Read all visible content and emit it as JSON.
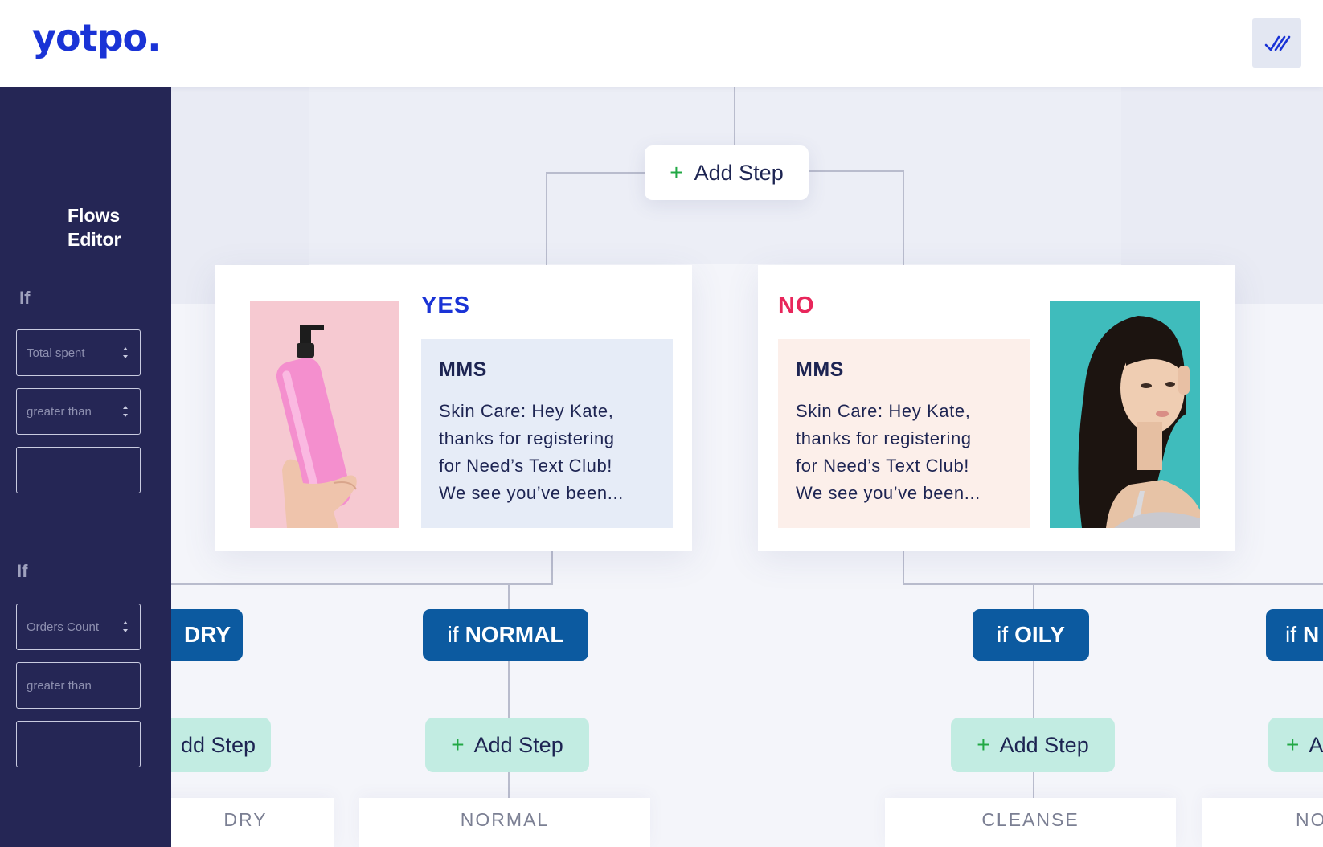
{
  "header": {
    "logo": "yotpo.",
    "check_icon": "double-check-icon"
  },
  "sidebar": {
    "title_line1": "Flows",
    "title_line2": "Editor",
    "groups": [
      {
        "if_label": "If",
        "field1": "Total spent",
        "field2": "greater than",
        "field3": ""
      },
      {
        "if_label": "If",
        "field1": "Orders Count",
        "field2": "greater than",
        "field3": ""
      }
    ]
  },
  "flow": {
    "top_add_step": "Add Step",
    "yes": {
      "label": "YES",
      "message_type": "MMS",
      "line1": "Skin Care: Hey Kate,",
      "line2": "thanks for registering",
      "line3": "for Need’s Text Club!",
      "line4": "We see you’ve been..."
    },
    "no": {
      "label": "NO",
      "message_type": "MMS",
      "line1": "Skin Care: Hey Kate,",
      "line2": "thanks for registering",
      "line3": "for Need’s Text Club!",
      "line4": "We see you’ve been..."
    },
    "conditions": [
      {
        "prefix": "",
        "value": "DRY"
      },
      {
        "prefix": "if",
        "value": "NORMAL"
      },
      {
        "prefix": "if",
        "value": "OILY"
      },
      {
        "prefix": "if",
        "value": "N"
      }
    ],
    "add_steps": [
      "dd Step",
      "Add Step",
      "Add Step",
      "A"
    ],
    "bottom_cards": [
      "DRY",
      "NORMAL",
      "CLEANSE",
      "NO"
    ]
  },
  "colors": {
    "brand": "#1a33d6",
    "yes": "#1a33d6",
    "no": "#e8265b",
    "condition_pill": "#0c5aa0",
    "add_step_pill": "#c2ece2",
    "sidebar": "#252655"
  }
}
